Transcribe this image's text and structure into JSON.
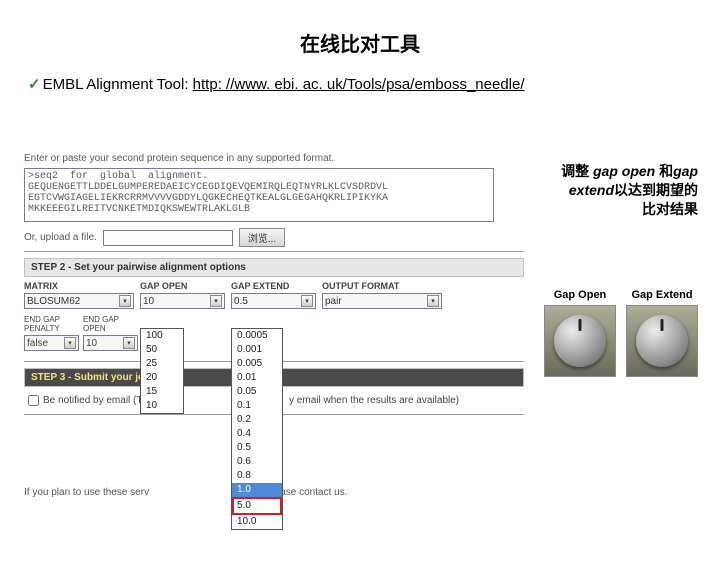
{
  "title": "在线比对工具",
  "subtitle_prefix": "EMBL Alignment Tool: ",
  "subtitle_link": "http: //www. ebi. ac. uk/Tools/psa/emboss_needle/",
  "panel": {
    "sec_prompt": "Enter or paste your second protein sequence in any supported format.",
    "seq_text": ">seq2  for  global  alignment.\nGEQUENGETTLDDELGUMPEREDAEICYCEGDIQEVQEMIRQLEQTNYRLKLCVSDRDVL\nEGTCVWGIAGELIEKRCRRMVVVVGDDYLQGKECHEQTKEALGLGEGAHQKRLIPIKYKA\nMKKEEEGILREITVCNKETMDIQKSWEWTRLAKLGLB",
    "upload_label": "Or, upload a file.",
    "browse_btn": "浏览...",
    "step2": "STEP 2 - Set your pairwise alignment options",
    "cols": {
      "matrix": "MATRIX",
      "gapopen": "GAP OPEN",
      "gapextend": "GAP EXTEND",
      "output": "OUTPUT FORMAT"
    },
    "vals": {
      "matrix": "BLOSUM62",
      "gapopen": "10",
      "gapextend": "0.5",
      "output": "pair"
    },
    "sub": {
      "endgap_penalty": "END GAP\nPENALTY",
      "endgap_open": "END GAP\nOPEN",
      "endgap_penalty_val": "false",
      "endgap_open_val": "10"
    },
    "step3": "STEP 3 - Submit your job",
    "notify": "Be notified by email  (Tick this b",
    "notify_tail": "y email when the results are available)",
    "footer": "If you plan to use these serv",
    "footer_tail": "urse please contact us."
  },
  "gapopen_options": [
    "100",
    "50",
    "25",
    "20",
    "15",
    "10"
  ],
  "gapext_options": [
    "0.0005",
    "0.001",
    "0.005",
    "0.01",
    "0.05",
    "0.1",
    "0.2",
    "0.4",
    "0.5",
    "0.6",
    "0.8",
    "1.0",
    "5.0",
    "10.0"
  ],
  "gapext_highlight_blue": "1.0",
  "gapext_highlight_red": "5.0",
  "tip": {
    "l1_a": "调整 ",
    "l1_b": "gap open ",
    "l1_c": "和",
    "l1_d": "gap",
    "l2_a": "extend",
    "l2_b": "以达到期望的",
    "l3": "比对结果"
  },
  "knobs": {
    "open": "Gap Open",
    "extend": "Gap Extend"
  }
}
